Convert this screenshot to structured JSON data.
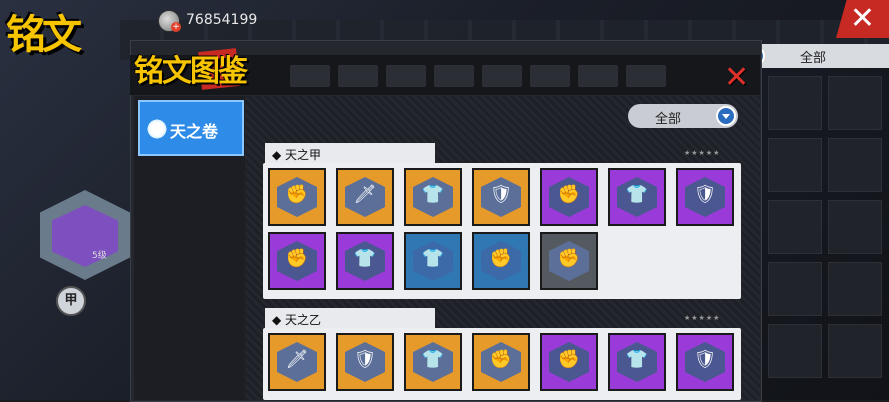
{
  "header": {
    "title": "铭文",
    "currency": "76854199"
  },
  "filter_bg": {
    "label": "全部"
  },
  "badge": {
    "level": "5级",
    "char": "甲"
  },
  "panel": {
    "title": "铭文图鉴",
    "close": "✕",
    "tab": "天之卷",
    "filter": "全部",
    "sections": [
      {
        "label": "◆ 天之甲",
        "stars": "★★★★★",
        "items": [
          {
            "color": "orange",
            "icon": "fist-icon"
          },
          {
            "color": "orange",
            "icon": "knife-icon"
          },
          {
            "color": "orange",
            "icon": "shirt-icon"
          },
          {
            "color": "orange",
            "icon": "shield-icon"
          },
          {
            "color": "purple",
            "icon": "fist-icon"
          },
          {
            "color": "purple",
            "icon": "shirt-icon"
          },
          {
            "color": "purple",
            "icon": "shield-icon"
          },
          {
            "color": "purple",
            "icon": "fist-icon"
          },
          {
            "color": "purple",
            "icon": "shirt-icon"
          },
          {
            "color": "blue",
            "icon": "shirt-icon"
          },
          {
            "color": "blue",
            "icon": "fist-icon"
          },
          {
            "color": "gray",
            "icon": "fist-icon"
          }
        ]
      },
      {
        "label": "◆ 天之乙",
        "stars": "★★★★★",
        "items": [
          {
            "color": "orange",
            "icon": "knife-icon"
          },
          {
            "color": "orange",
            "icon": "shield-icon"
          },
          {
            "color": "orange",
            "icon": "shirt-icon"
          },
          {
            "color": "orange",
            "icon": "fist-icon"
          },
          {
            "color": "purple",
            "icon": "fist-icon"
          },
          {
            "color": "purple",
            "icon": "shirt-icon"
          },
          {
            "color": "purple",
            "icon": "shield-icon"
          }
        ]
      }
    ]
  },
  "icon_glyphs": {
    "fist-icon": "✊",
    "knife-icon": "🗡",
    "shirt-icon": "👕",
    "shield-icon": "🛡"
  }
}
